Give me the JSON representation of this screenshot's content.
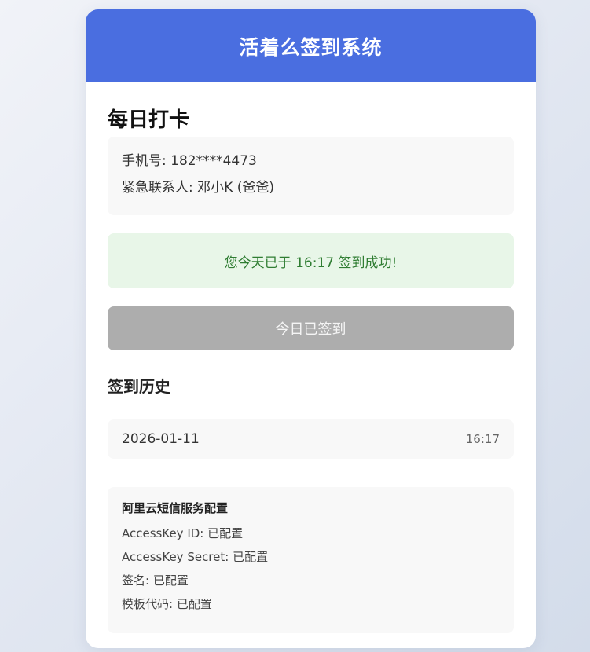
{
  "header": {
    "title": "活着么签到系统"
  },
  "checkin": {
    "section_title": "每日打卡",
    "phone_label": "手机号:",
    "phone_value": "182****4473",
    "contact_label": "紧急联系人:",
    "contact_value": "邓小K (爸爸)",
    "success_message": "您今天已于 16:17 签到成功!",
    "button_label": "今日已签到"
  },
  "history": {
    "title": "签到历史",
    "items": [
      {
        "date": "2026-01-11",
        "time": "16:17"
      }
    ]
  },
  "sms_config": {
    "title": "阿里云短信服务配置",
    "items": [
      {
        "label": "AccessKey ID:",
        "value": "已配置"
      },
      {
        "label": "AccessKey Secret:",
        "value": "已配置"
      },
      {
        "label": "签名:",
        "value": "已配置"
      },
      {
        "label": "模板代码:",
        "value": "已配置"
      }
    ]
  },
  "colors": {
    "header_bg": "#4a6ee0",
    "success_bg": "#e8f6e8",
    "success_text": "#2f7d32",
    "button_disabled_bg": "#adadad"
  }
}
